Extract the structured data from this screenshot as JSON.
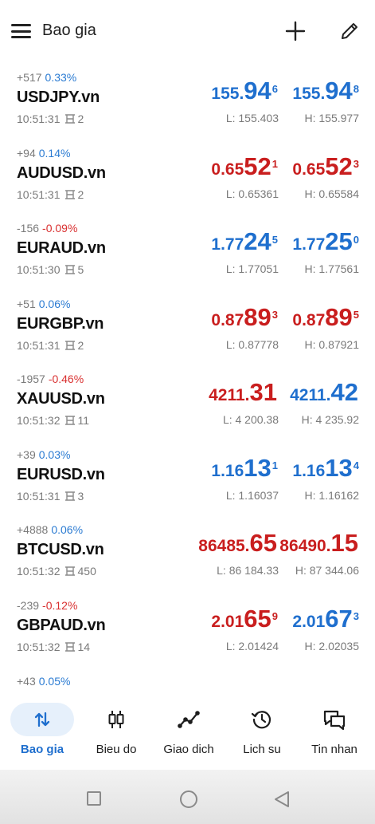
{
  "header": {
    "title": "Bao gia",
    "menu_icon": "hamburger-icon",
    "add_icon": "plus-icon",
    "edit_icon": "pencil-icon"
  },
  "quotes": [
    {
      "change": "+517",
      "percent": "0.33%",
      "percent_dir": "pos",
      "symbol": "USDJPY.vn",
      "time": "10:51:31",
      "spread": "2",
      "bid": {
        "small": "155.",
        "big": "94",
        "sup": "6",
        "color": "blue"
      },
      "ask": {
        "small": "155.",
        "big": "94",
        "sup": "8",
        "color": "blue"
      },
      "low": "L: 155.403",
      "high": "H: 155.977"
    },
    {
      "change": "+94",
      "percent": "0.14%",
      "percent_dir": "pos",
      "symbol": "AUDUSD.vn",
      "time": "10:51:31",
      "spread": "2",
      "bid": {
        "small": "0.65",
        "big": "52",
        "sup": "1",
        "color": "red"
      },
      "ask": {
        "small": "0.65",
        "big": "52",
        "sup": "3",
        "color": "red"
      },
      "low": "L: 0.65361",
      "high": "H: 0.65584"
    },
    {
      "change": "-156",
      "percent": "-0.09%",
      "percent_dir": "neg",
      "symbol": "EURAUD.vn",
      "time": "10:51:30",
      "spread": "5",
      "bid": {
        "small": "1.77",
        "big": "24",
        "sup": "5",
        "color": "blue"
      },
      "ask": {
        "small": "1.77",
        "big": "25",
        "sup": "0",
        "color": "blue"
      },
      "low": "L: 1.77051",
      "high": "H: 1.77561"
    },
    {
      "change": "+51",
      "percent": "0.06%",
      "percent_dir": "pos",
      "symbol": "EURGBP.vn",
      "time": "10:51:31",
      "spread": "2",
      "bid": {
        "small": "0.87",
        "big": "89",
        "sup": "3",
        "color": "red"
      },
      "ask": {
        "small": "0.87",
        "big": "89",
        "sup": "5",
        "color": "red"
      },
      "low": "L: 0.87778",
      "high": "H: 0.87921"
    },
    {
      "change": "-1957",
      "percent": "-0.46%",
      "percent_dir": "neg",
      "symbol": "XAUUSD.vn",
      "time": "10:51:32",
      "spread": "11",
      "bid": {
        "small": "4211.",
        "big": "31",
        "sup": "",
        "color": "red"
      },
      "ask": {
        "small": "4211.",
        "big": "42",
        "sup": "",
        "color": "blue"
      },
      "low": "L: 4 200.38",
      "high": "H: 4 235.92"
    },
    {
      "change": "+39",
      "percent": "0.03%",
      "percent_dir": "pos",
      "symbol": "EURUSD.vn",
      "time": "10:51:31",
      "spread": "3",
      "bid": {
        "small": "1.16",
        "big": "13",
        "sup": "1",
        "color": "blue"
      },
      "ask": {
        "small": "1.16",
        "big": "13",
        "sup": "4",
        "color": "blue"
      },
      "low": "L: 1.16037",
      "high": "H: 1.16162"
    },
    {
      "change": "+4888",
      "percent": "0.06%",
      "percent_dir": "pos",
      "symbol": "BTCUSD.vn",
      "time": "10:51:32",
      "spread": "450",
      "bid": {
        "small": "86485.",
        "big": "65",
        "sup": "",
        "color": "red"
      },
      "ask": {
        "small": "86490.",
        "big": "15",
        "sup": "",
        "color": "red"
      },
      "low": "L: 86 184.33",
      "high": "H: 87 344.06"
    },
    {
      "change": "-239",
      "percent": "-0.12%",
      "percent_dir": "neg",
      "symbol": "GBPAUD.vn",
      "time": "10:51:32",
      "spread": "14",
      "bid": {
        "small": "2.01",
        "big": "65",
        "sup": "9",
        "color": "red"
      },
      "ask": {
        "small": "2.01",
        "big": "67",
        "sup": "3",
        "color": "blue"
      },
      "low": "L: 2.01424",
      "high": "H: 2.02035"
    }
  ],
  "partial_row": {
    "change": "+43",
    "percent": "0.05%"
  },
  "colors": {
    "blue": "#1f6fce",
    "red": "#c91e1e",
    "active_pill": "#e6f0fb"
  },
  "nav": [
    {
      "label": "Bao gia",
      "icon": "sort-arrows-icon",
      "active": true
    },
    {
      "label": "Bieu do",
      "icon": "candlestick-icon",
      "active": false
    },
    {
      "label": "Giao dich",
      "icon": "trend-line-icon",
      "active": false
    },
    {
      "label": "Lich su",
      "icon": "history-icon",
      "active": false
    },
    {
      "label": "Tin nhan",
      "icon": "chat-icon",
      "active": false
    }
  ]
}
